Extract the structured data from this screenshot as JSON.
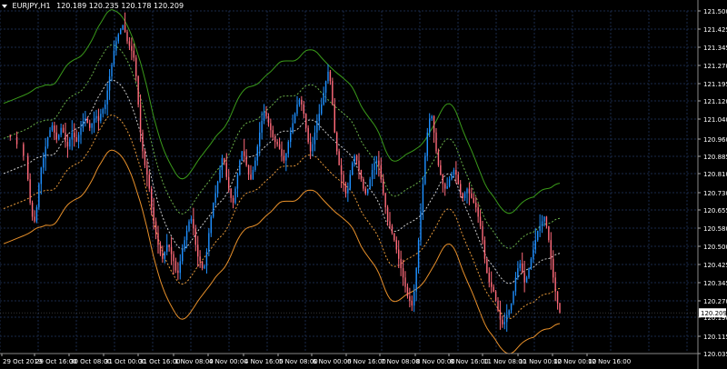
{
  "header": {
    "symbol": "EURJPY,H1",
    "ohlc": "120.189 120.235 120.178 120.209"
  },
  "chart_data": {
    "type": "candlestick",
    "symbol": "EURJPY,H1",
    "current_price": 120.209,
    "ylim": [
      120.0,
      121.5
    ],
    "y_ticks": [
      121.5,
      121.425,
      121.345,
      121.27,
      121.195,
      121.12,
      121.04,
      120.96,
      120.885,
      120.81,
      120.73,
      120.655,
      120.58,
      120.5,
      120.425,
      120.345,
      120.27,
      120.19,
      120.115,
      120.035
    ],
    "y_tick_labels": [
      "121.500",
      "121.425",
      "121.345",
      "121.270",
      "121.195",
      "121.120",
      "121.040",
      "120.960",
      "120.885",
      "120.810",
      "120.730",
      "120.655",
      "120.580",
      "120.500",
      "120.425",
      "120.345",
      "120.270",
      "120.190",
      "120.115",
      "120.035"
    ],
    "current_price_label": "120.209",
    "x_ticks": [
      "29 Oct 2019",
      "29 Oct 16:00",
      "30 Oct 08:00",
      "31 Oct 00:00",
      "31 Oct 16:00",
      "1 Nov 08:00",
      "4 Nov 00:00",
      "4 Nov 16:00",
      "5 Nov 08:00",
      "6 Nov 00:00",
      "6 Nov 16:00",
      "7 Nov 08:00",
      "8 Nov 00:00",
      "8 Nov 16:00",
      "11 Nov 08:00",
      "11 Nov 00:00",
      "12 Nov 00:00",
      "12 Nov 16:00"
    ],
    "price_path": [
      [
        0,
        120.97
      ],
      [
        6,
        120.96
      ],
      [
        12,
        120.93
      ],
      [
        18,
        120.88
      ],
      [
        22,
        120.78
      ],
      [
        24,
        120.68
      ],
      [
        26,
        120.62
      ],
      [
        28,
        120.6
      ],
      [
        30,
        120.66
      ],
      [
        32,
        120.76
      ],
      [
        34,
        120.83
      ],
      [
        36,
        120.87
      ],
      [
        38,
        120.92
      ],
      [
        40,
        120.96
      ],
      [
        42,
        120.99
      ],
      [
        44,
        121.01
      ],
      [
        46,
        120.98
      ],
      [
        48,
        120.95
      ],
      [
        50,
        120.97
      ],
      [
        52,
        121.0
      ],
      [
        54,
        120.98
      ],
      [
        56,
        120.94
      ],
      [
        58,
        120.92
      ],
      [
        60,
        120.95
      ],
      [
        62,
        120.98
      ],
      [
        64,
        120.96
      ],
      [
        66,
        120.94
      ],
      [
        68,
        120.97
      ],
      [
        70,
        121.0
      ],
      [
        72,
        121.03
      ],
      [
        74,
        121.04
      ],
      [
        76,
        121.02
      ],
      [
        78,
        121.0
      ],
      [
        80,
        121.02
      ],
      [
        82,
        121.04
      ],
      [
        84,
        121.05
      ],
      [
        86,
        121.03
      ],
      [
        88,
        121.06
      ],
      [
        90,
        121.08
      ],
      [
        92,
        121.1
      ],
      [
        94,
        121.16
      ],
      [
        96,
        121.22
      ],
      [
        98,
        121.27
      ],
      [
        100,
        121.33
      ],
      [
        102,
        121.37
      ],
      [
        104,
        121.4
      ],
      [
        106,
        121.42
      ],
      [
        108,
        121.44
      ],
      [
        110,
        121.41
      ],
      [
        112,
        121.37
      ],
      [
        114,
        121.35
      ],
      [
        116,
        121.33
      ],
      [
        118,
        121.3
      ],
      [
        120,
        121.22
      ],
      [
        122,
        121.1
      ],
      [
        124,
        120.98
      ],
      [
        126,
        120.9
      ],
      [
        128,
        120.84
      ],
      [
        130,
        120.8
      ],
      [
        132,
        120.74
      ],
      [
        134,
        120.66
      ],
      [
        136,
        120.6
      ],
      [
        138,
        120.55
      ],
      [
        140,
        120.5
      ],
      [
        142,
        120.46
      ],
      [
        144,
        120.44
      ],
      [
        146,
        120.47
      ],
      [
        148,
        120.5
      ],
      [
        150,
        120.49
      ],
      [
        152,
        120.46
      ],
      [
        154,
        120.43
      ],
      [
        156,
        120.39
      ],
      [
        158,
        120.38
      ],
      [
        160,
        120.43
      ],
      [
        162,
        120.48
      ],
      [
        164,
        120.52
      ],
      [
        166,
        120.56
      ],
      [
        168,
        120.6
      ],
      [
        170,
        120.61
      ],
      [
        172,
        120.57
      ],
      [
        174,
        120.5
      ],
      [
        176,
        120.45
      ],
      [
        178,
        120.43
      ],
      [
        180,
        120.4
      ],
      [
        182,
        120.41
      ],
      [
        184,
        120.47
      ],
      [
        186,
        120.55
      ],
      [
        188,
        120.62
      ],
      [
        190,
        120.68
      ],
      [
        192,
        120.72
      ],
      [
        194,
        120.77
      ],
      [
        196,
        120.82
      ],
      [
        198,
        120.87
      ],
      [
        200,
        120.85
      ],
      [
        202,
        120.79
      ],
      [
        204,
        120.74
      ],
      [
        206,
        120.7
      ],
      [
        208,
        120.68
      ],
      [
        210,
        120.74
      ],
      [
        212,
        120.8
      ],
      [
        214,
        120.86
      ],
      [
        216,
        120.9
      ],
      [
        218,
        120.88
      ],
      [
        220,
        120.84
      ],
      [
        222,
        120.8
      ],
      [
        224,
        120.78
      ],
      [
        226,
        120.82
      ],
      [
        228,
        120.86
      ],
      [
        230,
        120.92
      ],
      [
        232,
        120.98
      ],
      [
        234,
        121.03
      ],
      [
        236,
        121.07
      ],
      [
        238,
        121.05
      ],
      [
        240,
        121.02
      ],
      [
        242,
        120.99
      ],
      [
        244,
        120.96
      ],
      [
        246,
        120.94
      ],
      [
        248,
        120.93
      ],
      [
        250,
        120.91
      ],
      [
        252,
        120.88
      ],
      [
        254,
        120.86
      ],
      [
        256,
        120.89
      ],
      [
        258,
        120.94
      ],
      [
        260,
        120.98
      ],
      [
        262,
        121.02
      ],
      [
        264,
        121.06
      ],
      [
        266,
        121.1
      ],
      [
        268,
        121.12
      ],
      [
        270,
        121.1
      ],
      [
        272,
        121.06
      ],
      [
        274,
        121.0
      ],
      [
        276,
        120.94
      ],
      [
        278,
        120.9
      ],
      [
        280,
        120.93
      ],
      [
        282,
        120.98
      ],
      [
        284,
        121.03
      ],
      [
        286,
        121.06
      ],
      [
        288,
        121.1
      ],
      [
        290,
        121.15
      ],
      [
        292,
        121.2
      ],
      [
        294,
        121.24
      ],
      [
        296,
        121.2
      ],
      [
        298,
        121.1
      ],
      [
        300,
        120.98
      ],
      [
        302,
        120.9
      ],
      [
        304,
        120.84
      ],
      [
        306,
        120.8
      ],
      [
        308,
        120.76
      ],
      [
        310,
        120.72
      ],
      [
        312,
        120.74
      ],
      [
        314,
        120.8
      ],
      [
        316,
        120.85
      ],
      [
        318,
        120.88
      ],
      [
        320,
        120.86
      ],
      [
        322,
        120.82
      ],
      [
        324,
        120.78
      ],
      [
        326,
        120.74
      ],
      [
        328,
        120.72
      ],
      [
        330,
        120.74
      ],
      [
        332,
        120.78
      ],
      [
        334,
        120.82
      ],
      [
        336,
        120.85
      ],
      [
        338,
        120.86
      ],
      [
        340,
        120.84
      ],
      [
        342,
        120.78
      ],
      [
        344,
        120.72
      ],
      [
        346,
        120.66
      ],
      [
        348,
        120.6
      ],
      [
        350,
        120.58
      ],
      [
        352,
        120.55
      ],
      [
        354,
        120.52
      ],
      [
        356,
        120.48
      ],
      [
        358,
        120.44
      ],
      [
        360,
        120.4
      ],
      [
        362,
        120.36
      ],
      [
        364,
        120.32
      ],
      [
        366,
        120.28
      ],
      [
        368,
        120.26
      ],
      [
        370,
        120.24
      ],
      [
        372,
        120.3
      ],
      [
        374,
        120.4
      ],
      [
        376,
        120.52
      ],
      [
        378,
        120.64
      ],
      [
        380,
        120.76
      ],
      [
        382,
        120.88
      ],
      [
        384,
        120.98
      ],
      [
        386,
        121.04
      ],
      [
        388,
        121.05
      ],
      [
        390,
        120.98
      ],
      [
        392,
        120.9
      ],
      [
        394,
        120.84
      ],
      [
        396,
        120.8
      ],
      [
        398,
        120.76
      ],
      [
        400,
        120.74
      ],
      [
        402,
        120.75
      ],
      [
        404,
        120.78
      ],
      [
        406,
        120.8
      ],
      [
        408,
        120.82
      ],
      [
        410,
        120.8
      ],
      [
        412,
        120.76
      ],
      [
        414,
        120.72
      ],
      [
        416,
        120.7
      ],
      [
        418,
        120.72
      ],
      [
        420,
        120.74
      ],
      [
        422,
        120.72
      ],
      [
        424,
        120.7
      ],
      [
        426,
        120.68
      ],
      [
        428,
        120.66
      ],
      [
        430,
        120.62
      ],
      [
        432,
        120.58
      ],
      [
        434,
        120.52
      ],
      [
        436,
        120.44
      ],
      [
        438,
        120.38
      ],
      [
        440,
        120.34
      ],
      [
        442,
        120.32
      ],
      [
        444,
        120.3
      ],
      [
        446,
        120.26
      ],
      [
        448,
        120.22
      ],
      [
        450,
        120.18
      ],
      [
        452,
        120.16
      ],
      [
        454,
        120.17
      ],
      [
        456,
        120.2
      ],
      [
        458,
        120.22
      ],
      [
        460,
        120.25
      ],
      [
        462,
        120.3
      ],
      [
        464,
        120.36
      ],
      [
        466,
        120.4
      ],
      [
        468,
        120.42
      ],
      [
        470,
        120.38
      ],
      [
        472,
        120.34
      ],
      [
        474,
        120.36
      ],
      [
        476,
        120.4
      ],
      [
        478,
        120.44
      ],
      [
        480,
        120.48
      ],
      [
        482,
        120.52
      ],
      [
        484,
        120.56
      ],
      [
        486,
        120.58
      ],
      [
        488,
        120.6
      ],
      [
        490,
        120.62
      ],
      [
        492,
        120.58
      ],
      [
        494,
        120.52
      ],
      [
        496,
        120.44
      ],
      [
        498,
        120.36
      ],
      [
        500,
        120.3
      ],
      [
        502,
        120.25
      ],
      [
        504,
        120.21
      ]
    ],
    "envelope_bands": [
      {
        "name": "green-upper",
        "color": "#3a9a1a",
        "style": "solid",
        "offset": 0.3
      },
      {
        "name": "green-dash",
        "color": "#6ab04a",
        "style": "dashed",
        "offset": 0.15
      },
      {
        "name": "white-mid",
        "color": "#cccccc",
        "style": "dashed",
        "offset": 0.0
      },
      {
        "name": "orange-dash",
        "color": "#e89a3a",
        "style": "dashed",
        "offset": -0.15
      },
      {
        "name": "orange-lower",
        "color": "#e8902a",
        "style": "solid",
        "offset": -0.3
      }
    ],
    "colors": {
      "background": "#000000",
      "grid": "#1a2a4a",
      "bull": "#1e90ff",
      "bear": "#ff6a7a",
      "text": "#ffffff",
      "price_tag_bg": "#ffffff",
      "price_tag_fg": "#000000"
    },
    "grid": true
  }
}
